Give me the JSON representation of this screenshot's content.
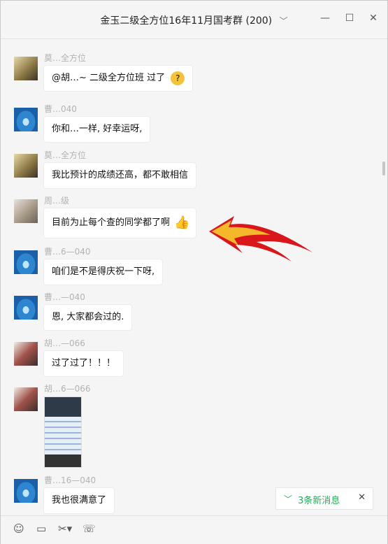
{
  "window": {
    "title": "金玉二级全方位16年11月国考群",
    "member_count": "(200)"
  },
  "messages": [
    {
      "sender": "莫…全方位",
      "text": "@胡…~ 二级全方位班 过了",
      "avatar": "photo-avatar"
    },
    {
      "sender": "曹…040",
      "text": "你和…一样, 好幸运呀,",
      "avatar": "blue-water-avatar"
    },
    {
      "sender": "莫…全方位",
      "text": "我比预计的成绩还高，都不敢相信",
      "avatar": "photo-avatar"
    },
    {
      "sender": "周…级",
      "text": "目前为止每个查的同学都了啊",
      "avatar": "photo-avatar"
    },
    {
      "sender": "曹…6—040",
      "text": "咱们是不是得庆祝一下呀,",
      "avatar": "blue-water-avatar"
    },
    {
      "sender": "曹…—040",
      "text": "恩, 大家都会过的.",
      "avatar": "blue-water-avatar"
    },
    {
      "sender": "胡…—066",
      "text": "过了过了！！！",
      "avatar": "photo-avatar"
    },
    {
      "sender": "胡…6—066",
      "text": "",
      "avatar": "photo-avatar"
    },
    {
      "sender": "曹…16—040",
      "text": "我也很满意了",
      "avatar": "blue-water-avatar"
    }
  ],
  "new_messages": {
    "label": "3条新消息"
  },
  "toolbar": {
    "icons": [
      "emoji-icon",
      "folder-icon",
      "scissors-icon",
      "video-call-icon"
    ]
  },
  "colors": {
    "accent_green": "#2ca85a",
    "bubble_bg": "#ffffff",
    "window_bg": "#f5f5f5"
  }
}
